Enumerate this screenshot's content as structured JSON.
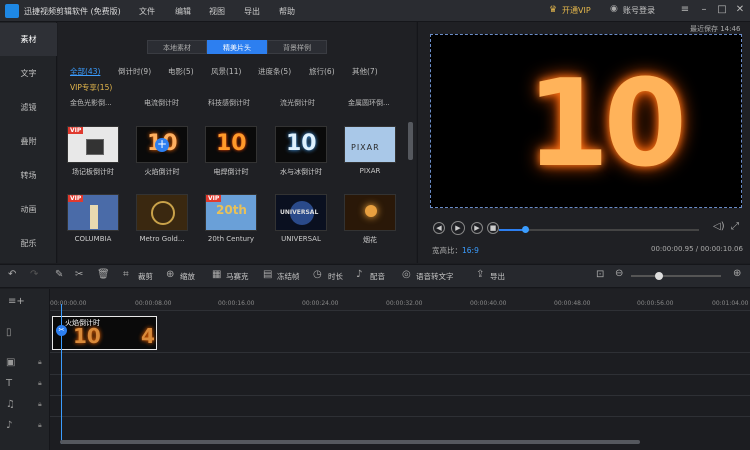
{
  "title_bar": {
    "app_title": "迅捷视频剪辑软件 (免费版)",
    "menu": [
      "文件",
      "编辑",
      "视图",
      "导出",
      "帮助"
    ],
    "vip_label": "开通VIP",
    "login_label": "账号登录"
  },
  "sidebar": {
    "items": [
      "素材",
      "文字",
      "滤镜",
      "叠附",
      "转场",
      "动画",
      "配乐"
    ]
  },
  "library": {
    "tabs": [
      "本地素材",
      "精美片头",
      "背景样例"
    ],
    "active_tab": "精美片头",
    "categories": [
      "全部(43)",
      "倒计时(9)",
      "电影(5)",
      "风景(11)",
      "进度条(5)",
      "旅行(6)",
      "其他(7)"
    ],
    "vip_label": "VIP专享(15)",
    "row_labels": [
      "金色光影倒...",
      "电流倒计时",
      "科技感倒计时",
      "流光倒计时",
      "金属圆环倒..."
    ],
    "items": [
      {
        "caption": "场记板倒计时"
      },
      {
        "caption": "火焰倒计时"
      },
      {
        "caption": "电焊倒计时"
      },
      {
        "caption": "水与冰倒计时"
      },
      {
        "caption": "PIXAR"
      },
      {
        "caption": "COLUMBIA"
      },
      {
        "caption": "Metro Gold..."
      },
      {
        "caption": "20th Century"
      },
      {
        "caption": "UNIVERSAL"
      },
      {
        "caption": "烟花"
      }
    ]
  },
  "preview": {
    "autosave": "最近保存 14:46",
    "number": "10",
    "aspect_label": "宽高比：",
    "aspect_value": "16:9",
    "time_readout": "00:00:00.95 / 00:00:10.06",
    "progress": 0.13
  },
  "toolbar": {
    "items": [
      "裁剪",
      "缩放",
      "马赛克",
      "冻结帧",
      "时长",
      "配音",
      "语音转文字",
      "导出"
    ]
  },
  "timeline": {
    "ticks": [
      "00:00:00.00",
      "00:00:08.00",
      "00:00:16.00",
      "00:00:24.00",
      "00:00:32.00",
      "00:00:40.00",
      "00:00:48.00",
      "00:00:56.00",
      "00:01:04.00"
    ],
    "clip_label": "火焰倒计时",
    "clip_text_a": "10",
    "clip_text_b": "4"
  }
}
